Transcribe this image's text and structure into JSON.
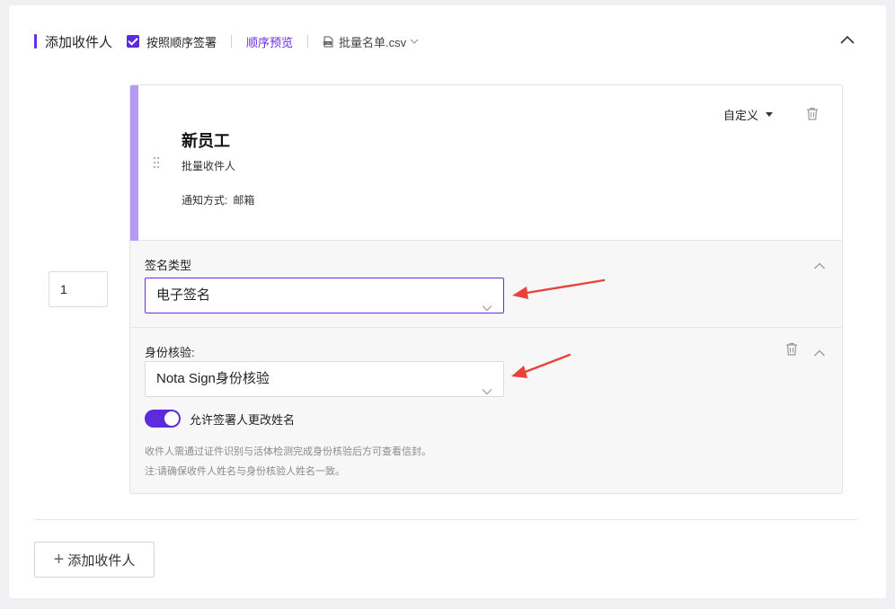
{
  "header": {
    "title": "添加收件人",
    "ordered_signing_label": "按照顺序签署",
    "ordered_signing_checked": true,
    "preview_link": "顺序预览",
    "csv_file": "批量名单.csv"
  },
  "recipient": {
    "order": "1",
    "name": "新员工",
    "subtitle": "批量收件人",
    "notify_label": "通知方式:",
    "notify_value": "邮箱",
    "role_dropdown": "自定义"
  },
  "signature": {
    "label": "签名类型",
    "value": "电子签名"
  },
  "identity": {
    "label": "身份核验:",
    "value": "Nota Sign身份核验",
    "allow_rename_label": "允许签署人更改姓名",
    "allow_rename_enabled": true,
    "note_1": "收件人需通过证件识别与活体检测完成身份核验后方可查看信封。",
    "note_2": "注:请确保收件人姓名与身份核验人姓名一致。"
  },
  "footer": {
    "add_recipient_label": "添加收件人"
  },
  "colors": {
    "accent": "#6a2ce8",
    "card_accent": "#b69af5",
    "annotation_arrow": "#e8433a"
  },
  "icons": {
    "csv": "file-csv-icon",
    "chevron": "chevron-down-icon",
    "collapse": "chevron-up-icon",
    "trash": "trash-icon",
    "drag": "drag-handle-icon",
    "plus": "plus-icon"
  }
}
